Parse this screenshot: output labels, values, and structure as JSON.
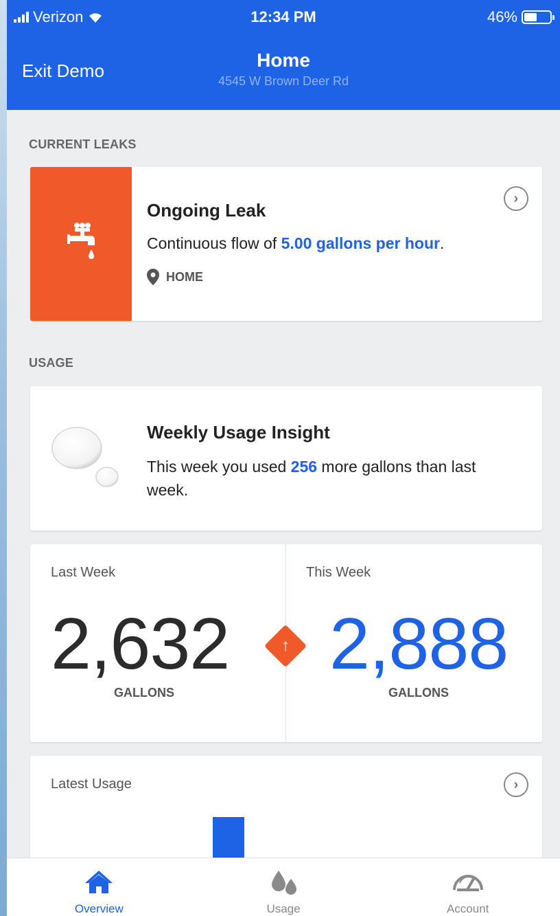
{
  "status_bar": {
    "carrier": "Verizon",
    "time": "12:34 PM",
    "battery": "46%"
  },
  "header": {
    "exit_label": "Exit Demo",
    "title": "Home",
    "subtitle": "4545 W Brown Deer Rd"
  },
  "leaks": {
    "section_label": "CURRENT LEAKS",
    "card": {
      "title": "Ongoing Leak",
      "desc_prefix": "Continuous flow of ",
      "desc_highlight": "5.00 gallons per hour",
      "desc_suffix": ".",
      "location": "HOME",
      "icon": "faucet-icon"
    }
  },
  "usage": {
    "section_label": "USAGE",
    "insight": {
      "title": "Weekly Usage Insight",
      "text_prefix": "This week you used ",
      "text_highlight": "256",
      "text_suffix": " more gallons than last week.",
      "icon": "water-drops-icon"
    },
    "comparison": {
      "last_week_label": "Last Week",
      "last_week_value": "2,632",
      "this_week_label": "This Week",
      "this_week_value": "2,888",
      "unit": "GALLONS",
      "trend_icon": "arrow-up-icon"
    },
    "latest": {
      "title": "Latest Usage"
    }
  },
  "tabs": [
    {
      "label": "Overview",
      "icon": "home-icon",
      "active": true
    },
    {
      "label": "Usage",
      "icon": "droplets-icon",
      "active": false
    },
    {
      "label": "Account",
      "icon": "gauge-icon",
      "active": false
    }
  ],
  "colors": {
    "primary": "#1e62e6",
    "alert": "#f05a2b",
    "background": "#edeef0"
  }
}
